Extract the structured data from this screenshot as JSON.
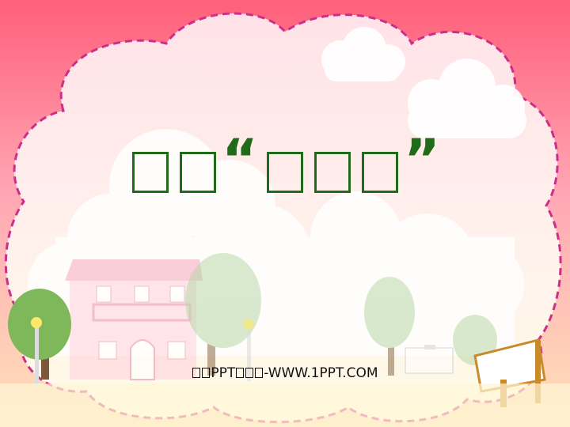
{
  "title": {
    "glyphs_before": 2,
    "open_quote": "“",
    "glyphs_inside": 3,
    "close_quote": "”"
  },
  "subtitle": {
    "lead_glyphs": 2,
    "brand_text": "PPT",
    "mid_glyphs": 3,
    "site_text": "-WWW.1PPT.COM"
  },
  "colors": {
    "title": "#1f6b1a",
    "frame_border": "#cc2e8a",
    "sky_top": "#ff5f7a",
    "sky_bottom": "#ffd7a8"
  }
}
